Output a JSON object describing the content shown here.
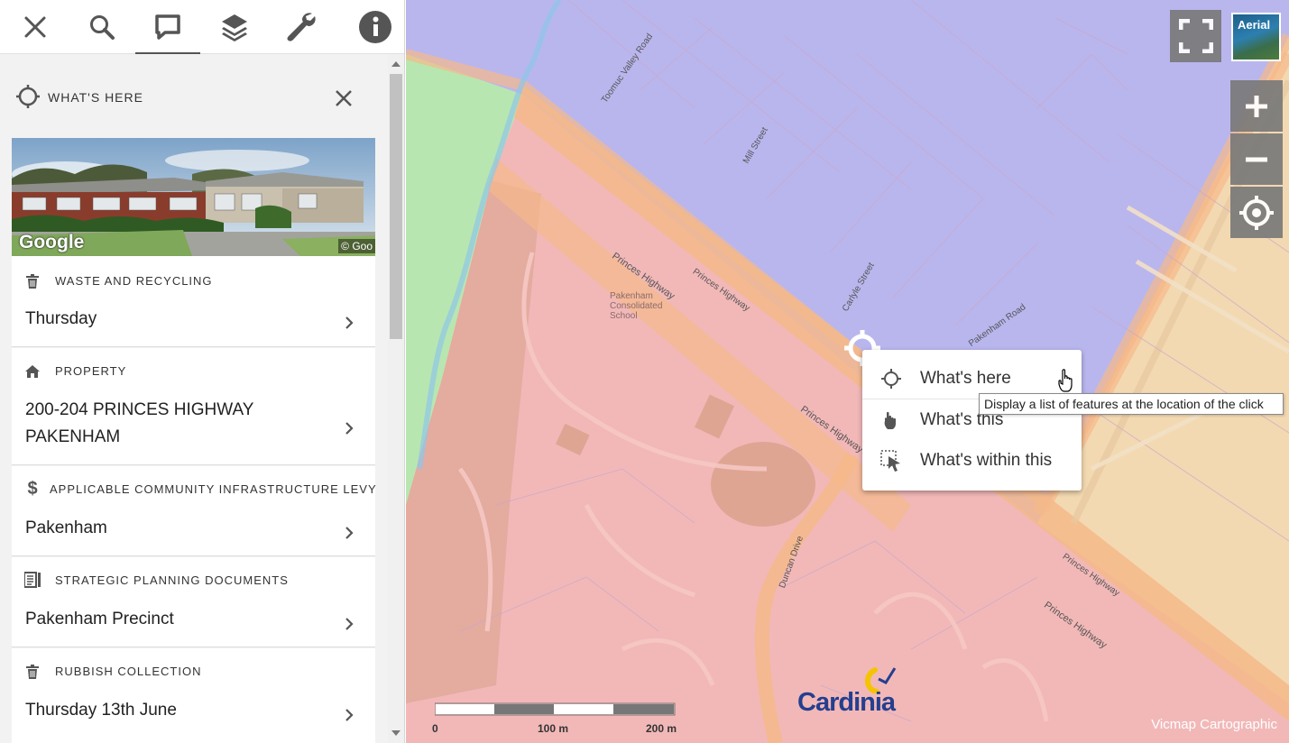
{
  "toolbar": {
    "items": [
      "close-icon",
      "search-icon",
      "comment-icon",
      "layers-icon",
      "wrench-icon",
      "info-icon"
    ],
    "active": "comment-icon"
  },
  "panel": {
    "title": "WHAT'S HERE",
    "street_view": {
      "brand": "Google",
      "copyright": "© Goo"
    }
  },
  "cards": [
    {
      "icon": "trash-icon",
      "category": "WASTE AND RECYCLING",
      "value": "Thursday"
    },
    {
      "icon": "home-icon",
      "category": "PROPERTY",
      "value": "200-204 PRINCES HIGHWAY PAKENHAM"
    },
    {
      "icon": "dollar-icon",
      "category": "APPLICABLE COMMUNITY INFRASTRUCTURE LEVY",
      "value": "Pakenham"
    },
    {
      "icon": "document-icon",
      "category": "STRATEGIC PLANNING DOCUMENTS",
      "value": "Pakenham Precinct"
    },
    {
      "icon": "trash-icon",
      "category": "RUBBISH COLLECTION",
      "value": "Thursday 13th June"
    }
  ],
  "map": {
    "basemap_toggle_label": "Aerial",
    "context_menu": [
      {
        "icon": "crosshair-icon",
        "label": "What's here"
      },
      {
        "icon": "hand-pointer-icon",
        "label": "What's this"
      },
      {
        "icon": "select-area-icon",
        "label": "What's within this"
      }
    ],
    "tooltip": "Display a list of features at the location of the click",
    "scale": {
      "labels": [
        "0",
        "100 m",
        "200 m"
      ]
    },
    "logo": "Cardinia",
    "attribution": "Vicmap Cartographic",
    "street_labels": [
      "Princes Highway",
      "Princes Highway",
      "Princes Highway",
      "Princes Highway",
      "Pakenham Road",
      "Carlyle Street",
      "Mill Street",
      "Duncan Drive",
      "Toomuc Valley Road",
      "Princes Highway"
    ],
    "place_labels": [
      "Pakenham Consolidated School"
    ],
    "colors": {
      "industrial": "#b9b6ee",
      "community": "#f2b8b8",
      "residential": "#f3d9b1",
      "park": "#b8e6b0",
      "road_zone": "#f5b98a"
    }
  }
}
